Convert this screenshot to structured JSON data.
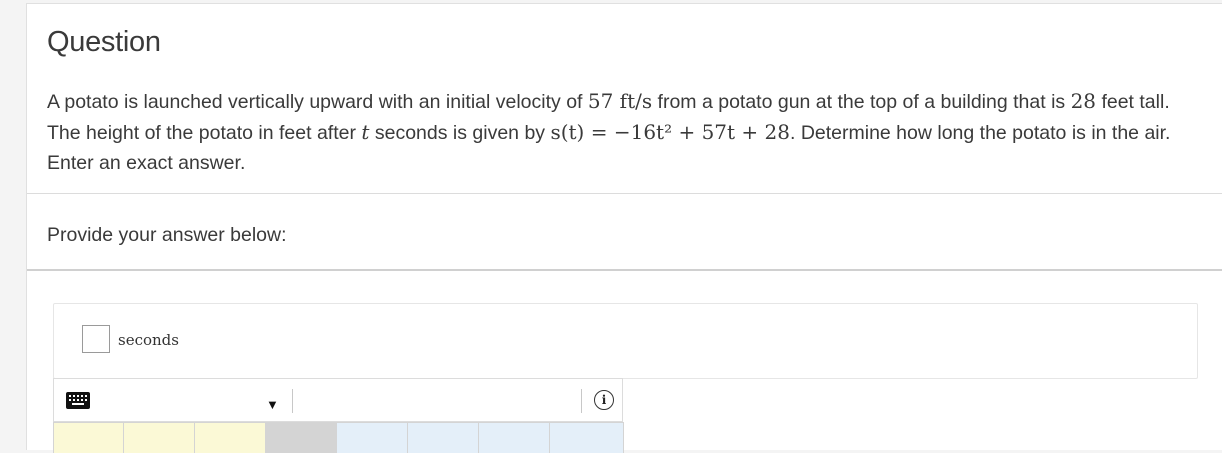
{
  "question": {
    "title": "Question",
    "text_1": "A potato is launched vertically upward with an initial velocity of ",
    "velocity": "57 ft/s",
    "text_2": " from a potato gun at the top of a building that is ",
    "height": "28",
    "text_3": " feet tall. The height of the potato in feet after ",
    "var_t": "t",
    "text_4": " seconds is given by ",
    "formula": "s(t) = −16t² + 57t + 28",
    "text_5": ". Determine how long the potato is in the air. Enter an exact answer."
  },
  "answer": {
    "prompt": "Provide your answer below:",
    "unit": "seconds"
  },
  "toolbar": {
    "keyboard_icon": "keyboard-icon",
    "dropdown_icon": "triangle-down-icon",
    "info_icon": "info-icon",
    "info_glyph": "i"
  },
  "keypad": {
    "colors": [
      "#fbf9d6",
      "#fbf9d6",
      "#fbf9d6",
      "#d4d4d4",
      "#e4eff9",
      "#e4eff9",
      "#e4eff9",
      "#e4eff9"
    ]
  }
}
